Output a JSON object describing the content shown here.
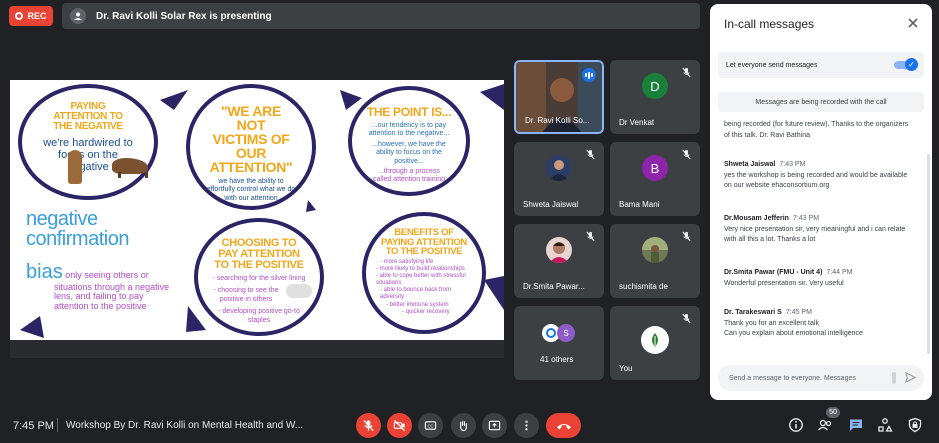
{
  "top": {
    "rec_label": "REC",
    "presenting_text": "Dr. Ravi Kolli Solar Rex is presenting"
  },
  "slide": {
    "c1_title": "PAYING ATTENTION TO THE NEGATIVE",
    "c1_body": "we're hardwired to focus on the negative",
    "c2_title": "\"WE ARE NOT VICTIMS OF OUR ATTENTION\"",
    "c2_body": "we have the ability to effortfully control what we do with our attention",
    "c3_title": "THE POINT IS...",
    "c3_body1": "...our tendency is to pay attention to the negative...",
    "c3_body2": "...however, we have the ability to focus on the positive...",
    "c3_body3": "...through a process called attention training",
    "neg_line1": "negative",
    "neg_line2": "confirmation",
    "neg_line3": "bias",
    "neg_desc": "only seeing others or situations through a negative lens, and failing to pay attention to the positive",
    "c4_title": "CHOOSING TO PAY ATTENTION TO THE POSITIVE",
    "c4_item1": "- searching for the silver lining",
    "c4_item2": "- choosing to see the positive in others",
    "c4_item3": "- developing positive go-to staples",
    "c5_title": "BENEFITS OF PAYING ATTENTION TO THE POSITIVE",
    "c5_item1": "- more satisfying life",
    "c5_item2": "- more likely to build relationships",
    "c5_item3": "- able to cope better with stressful situations",
    "c5_item4": "- able to bounce back from adversity",
    "c5_item5": "- better immune system",
    "c5_item6": "- quicker recovery"
  },
  "tiles": [
    {
      "name": "Dr. Ravi Kolli So...",
      "type": "photo"
    },
    {
      "name": "Dr Venkat",
      "initial": "D",
      "color": "#188038"
    },
    {
      "name": "Shweta Jaiswal",
      "type": "photo"
    },
    {
      "name": "Bama Mani",
      "initial": "B",
      "color": "#8e24aa"
    },
    {
      "name": "Dr.Smita Pawar...",
      "type": "photo"
    },
    {
      "name": "suchismita de",
      "type": "photo"
    },
    {
      "name": "41 others",
      "initial": "S"
    },
    {
      "name": "You",
      "type": "logo"
    }
  ],
  "panel": {
    "title": "In-call messages",
    "toggle_label": "Let everyone send messages",
    "recording_notice": "Messages are being recorded with the call",
    "messages": [
      {
        "who": "",
        "time": "",
        "text": "being recorded (for future review). Thanks to the organizers of this talk. Dr. Ravi Bathina"
      },
      {
        "who": "Shweta Jaiswal",
        "time": "7:43 PM",
        "text": "yes the workshop is being recorded and would be available on our website ehaconsortium.org"
      },
      {
        "who": "Dr.Mousam Jefferin",
        "time": "7:43 PM",
        "text": "Very nice presentation sir, very meaningful and i can relate with all this a lot. Thanks a lot"
      },
      {
        "who": "Dr.Smita Pawar (FMU - Unit 4)",
        "time": "7:44 PM",
        "text": "Wonderful presentation sir. Very useful"
      },
      {
        "who": "Dr. Tarakeswari S",
        "time": "7:45 PM",
        "text": "Thank you for an excellent talk"
      },
      {
        "who": "",
        "time": "",
        "text": "Can you explain about emotional intelligence"
      }
    ],
    "input_placeholder": "Send a message to everyone. Messages"
  },
  "bottom": {
    "time": "7:45 PM",
    "meeting_title": "Workshop By Dr. Ravi Kolli on Mental Health and W...",
    "participants_badge": "50"
  },
  "colors": {
    "accent": "#1a73e8",
    "danger": "#ea4335",
    "bg": "#202124",
    "tile": "#3c4043"
  }
}
